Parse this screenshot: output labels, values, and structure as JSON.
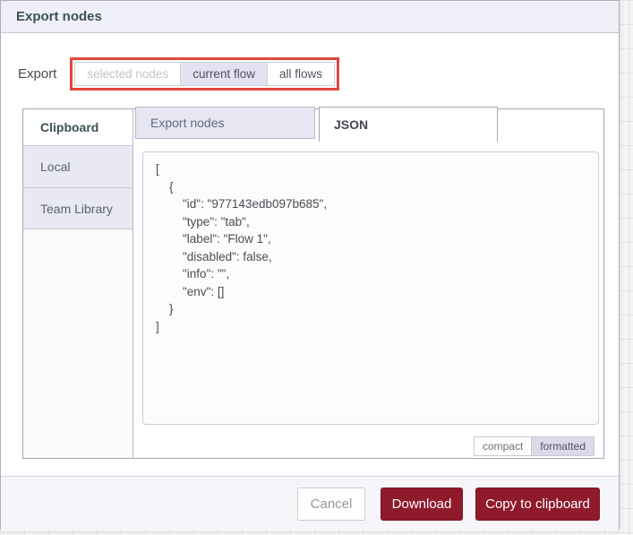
{
  "dialog": {
    "title": "Export nodes",
    "export_row": {
      "label": "Export",
      "options": [
        {
          "label": "selected nodes",
          "state": "disabled"
        },
        {
          "label": "current flow",
          "state": "selected"
        },
        {
          "label": "all flows",
          "state": "normal"
        }
      ]
    },
    "library": {
      "header": "Clipboard",
      "sidebar_items": [
        {
          "label": "Local"
        },
        {
          "label": "Team Library"
        }
      ],
      "tabs": [
        {
          "label": "Export nodes",
          "active": false
        },
        {
          "label": "JSON",
          "active": true
        }
      ],
      "json_content": "[\n    {\n        \"id\": \"977143edb097b685\",\n        \"type\": \"tab\",\n        \"label\": \"Flow 1\",\n        \"disabled\": false,\n        \"info\": \"\",\n        \"env\": []\n    }\n]",
      "format_buttons": [
        {
          "label": "compact",
          "selected": false
        },
        {
          "label": "formatted",
          "selected": true
        }
      ]
    },
    "footer": {
      "cancel_label": "Cancel",
      "download_label": "Download",
      "copy_label": "Copy to clipboard"
    }
  },
  "annotation": {
    "type": "highlight-box",
    "target": "export-scope-options",
    "color": "#e2473c"
  },
  "colors": {
    "primary_button": "#8f1a2c",
    "header_bg": "#efeff7",
    "selected_option_bg": "#e2e2f1",
    "inactive_tab_bg": "#e7e7f3"
  }
}
